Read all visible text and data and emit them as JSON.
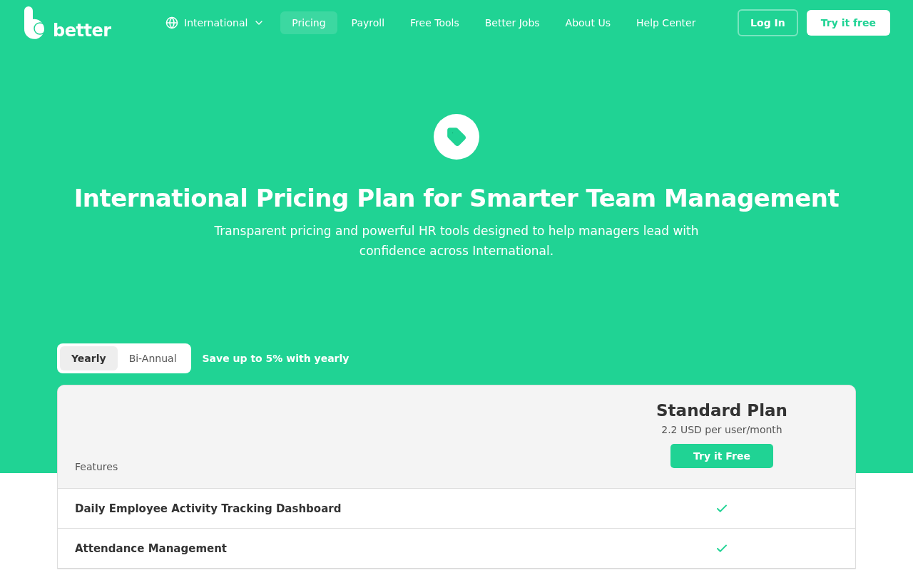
{
  "header": {
    "logo": "better",
    "region": "International",
    "nav": [
      {
        "label": "Pricing",
        "selected": true
      },
      {
        "label": "Payroll",
        "selected": false
      },
      {
        "label": "Free Tools",
        "selected": false
      },
      {
        "label": "Better Jobs",
        "selected": false
      },
      {
        "label": "About Us",
        "selected": false
      },
      {
        "label": "Help Center",
        "selected": false
      }
    ],
    "login": "Log In",
    "cta": "Try it free"
  },
  "hero": {
    "title": "International Pricing Plan for Smarter Team Management",
    "subtitle": "Transparent pricing and powerful HR tools designed to help managers lead with confidence across International."
  },
  "billing": {
    "options": [
      {
        "label": "Yearly",
        "selected": true
      },
      {
        "label": "Bi-Annual",
        "selected": false
      }
    ],
    "note": "Save up to 5% with yearly"
  },
  "table": {
    "features_label": "Features",
    "plan": {
      "name": "Standard Plan",
      "price": "2.2 USD per user/month",
      "button": "Try it Free"
    },
    "rows": [
      {
        "feature": "Daily Employee Activity Tracking Dashboard",
        "included": true
      },
      {
        "feature": "Attendance Management",
        "included": true
      }
    ]
  }
}
